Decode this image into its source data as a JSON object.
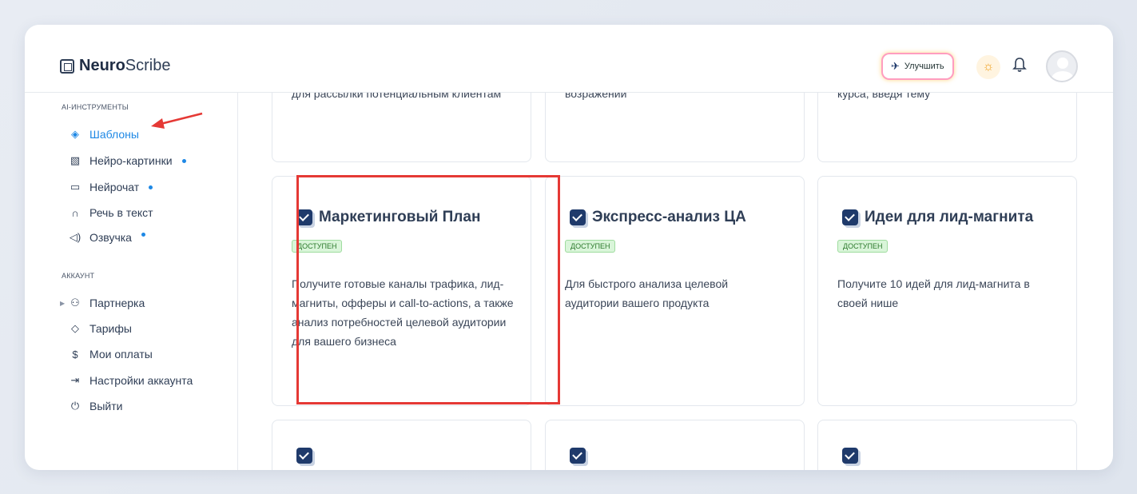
{
  "logo": {
    "bold": "Neuro",
    "rest": "Scribe"
  },
  "header": {
    "upgrade_label": "Улучшить"
  },
  "sidebar": {
    "section_ai": "AI-ИНСТРУМЕНТЫ",
    "ai_items": [
      {
        "label": "Шаблоны",
        "icon": "layers-icon",
        "active": true
      },
      {
        "label": "Нейро-картинки",
        "icon": "image-icon",
        "dot": true
      },
      {
        "label": "Нейрочат",
        "icon": "chat-icon",
        "dot": true
      },
      {
        "label": "Речь в текст",
        "icon": "headphones-icon"
      },
      {
        "label": "Озвучка",
        "icon": "speaker-icon",
        "dot": true
      }
    ],
    "section_account": "АККАУНТ",
    "account_items": [
      {
        "label": "Партнерка",
        "icon": "users-icon"
      },
      {
        "label": "Тарифы",
        "icon": "tag-icon"
      },
      {
        "label": "Мои оплаты",
        "icon": "dollar-icon"
      },
      {
        "label": "Настройки аккаунта",
        "icon": "login-icon"
      },
      {
        "label": "Выйти",
        "icon": "power-icon"
      }
    ]
  },
  "cards_top": [
    {
      "desc": "для рассылки потенциальным клиентам"
    },
    {
      "desc": "возражений"
    },
    {
      "desc": "курса, введя тему"
    }
  ],
  "cards": [
    {
      "title": "Маркетинговый План",
      "badge": "ДОСТУПЕН",
      "desc": "Получите готовые каналы трафика, лид-магниты, офферы и call-to-actions, а также анализ потребностей целевой аудитории для вашего бизнеса"
    },
    {
      "title": "Экспресс-анализ ЦА",
      "badge": "ДОСТУПЕН",
      "desc": "Для быстрого анализа целевой аудитории вашего продукта"
    },
    {
      "title": "Идеи для лид-магнита",
      "badge": "ДОСТУПЕН",
      "desc": "Получите 10 идей для лид-магнита в своей нише"
    }
  ],
  "colors": {
    "accent": "#1e88e5",
    "highlight": "#e53935",
    "badge_bg": "#d9f5d9",
    "badge_text": "#2d7a2d"
  }
}
